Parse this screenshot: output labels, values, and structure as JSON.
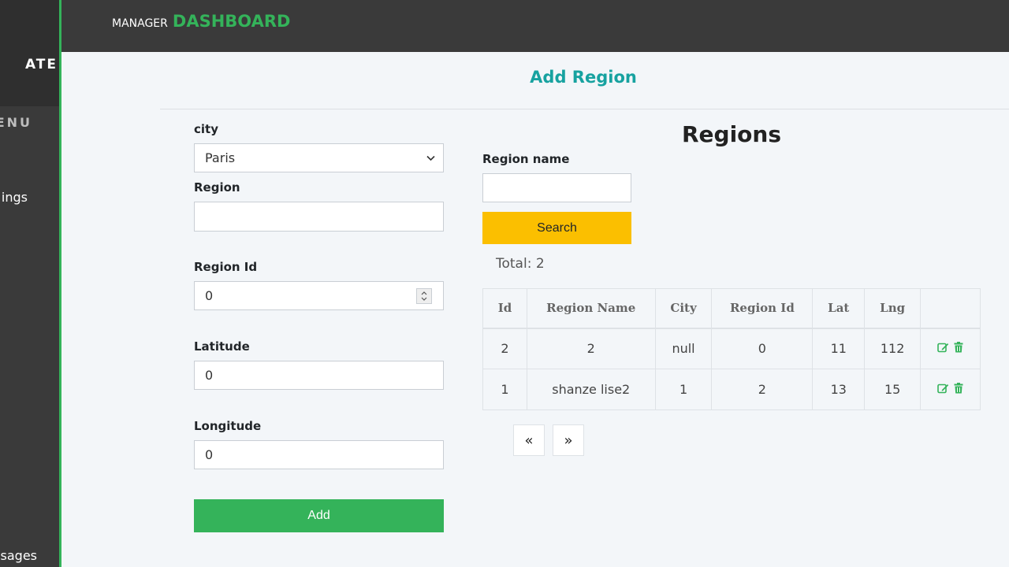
{
  "sidebar": {
    "brand_fragment": "ATE",
    "menu_fragment": "ENU",
    "items": [
      {
        "label": "ings"
      },
      {
        "label": "sages"
      }
    ]
  },
  "header": {
    "manager": "MANAGER",
    "dashboard": "DASHBOARD"
  },
  "page": {
    "title": "Add Region"
  },
  "form": {
    "city_label": "city",
    "city_value": "Paris",
    "region_label": "Region",
    "region_value": "",
    "region_id_label": "Region Id",
    "region_id_value": "0",
    "latitude_label": "Latitude",
    "latitude_value": "0",
    "longitude_label": "Longitude",
    "longitude_value": "0",
    "add_label": "Add"
  },
  "regions": {
    "title": "Regions",
    "search_label": "Region name",
    "search_value": "",
    "search_button": "Search",
    "total_text": "Total: 2",
    "columns": [
      "Id",
      "Region Name",
      "City",
      "Region Id",
      "Lat",
      "Lng",
      ""
    ],
    "rows": [
      [
        "2",
        "2",
        "null",
        "0",
        "11",
        "112"
      ],
      [
        "1",
        "shanze lise2",
        "1",
        "2",
        "13",
        "15"
      ]
    ],
    "pager_prev": "«",
    "pager_next": "»"
  },
  "colors": {
    "accent_green": "#34b35a",
    "title_teal": "#17a2a0",
    "search_yellow": "#fbbf00",
    "sidebar_dark": "#3a3a3a"
  },
  "icons": [
    "edit-icon",
    "trash-icon",
    "chevron-down-icon",
    "spinner-icon"
  ]
}
